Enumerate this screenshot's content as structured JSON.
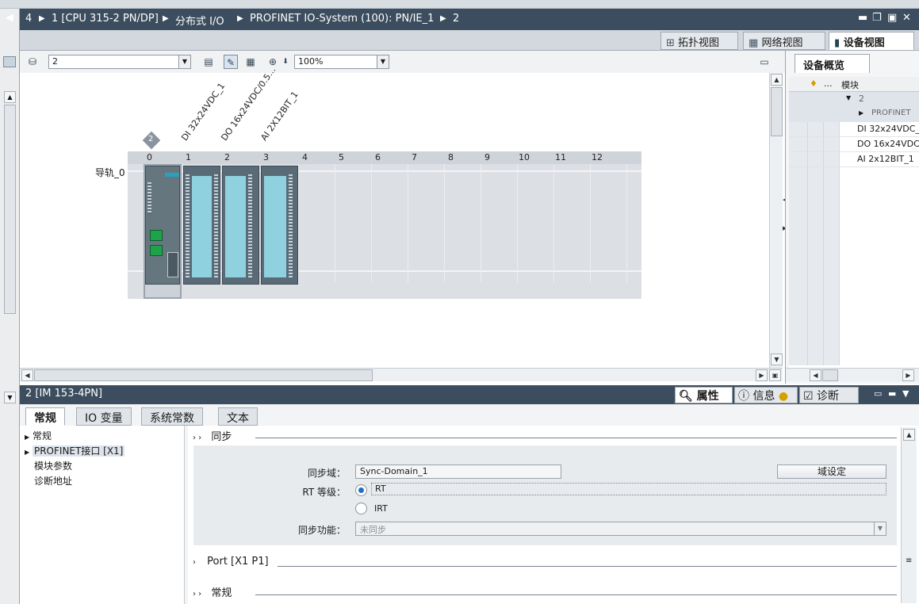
{
  "titlebar": {
    "crumbs": [
      "4",
      "1 [CPU 315-2 PN/DP]",
      "分布式 I/O",
      "PROFINET IO-System (100): PN/IE_1",
      "2"
    ]
  },
  "view_tabs": {
    "topology": "拓扑视图",
    "network": "网络视图",
    "device": "设备视图"
  },
  "device_toolbar": {
    "device_select": "2",
    "zoom": "100%"
  },
  "rack": {
    "rail_label": "导轨_0",
    "slots": [
      "0",
      "1",
      "2",
      "3",
      "4",
      "5",
      "6",
      "7",
      "8",
      "9",
      "10",
      "11",
      "12"
    ],
    "station_badge": "2",
    "module_labels": [
      "DI 32x24VDC_1",
      "DO 16x24VDC/0.5...",
      "AI 2X12BIT_1"
    ]
  },
  "overview": {
    "tab": "设备概览",
    "col_module": "模块",
    "col_dots": "...",
    "rows": [
      "2",
      "PROFINET",
      "DI 32x24VDC_",
      "DO 16x24VDC",
      "AI 2x12BIT_1"
    ]
  },
  "properties": {
    "title": "2 [IM 153-4PN]",
    "tabs": {
      "props": "属性",
      "info": "信息",
      "diag": "诊断"
    },
    "inner_tabs": [
      "常规",
      "IO 变量",
      "系统常数",
      "文本"
    ],
    "nav": [
      "常规",
      "PROFINET接口 [X1]",
      "模块参数",
      "诊断地址"
    ],
    "sections": {
      "sync": "同步",
      "port": "Port [X1 P1]",
      "general": "常规"
    },
    "sync_domain_label": "同步域：",
    "sync_domain_value": "Sync-Domain_1",
    "domain_settings_button": "域设定",
    "rt_class_label": "RT 等级：",
    "rt_option": "RT",
    "irt_option": "IRT",
    "sync_function_label": "同步功能：",
    "sync_function_value": "未同步",
    "rt_selected": "RT"
  },
  "colors": {
    "titlebar": "#3b4d5e",
    "module_body": "#5a6b78",
    "module_window": "#8fd1df",
    "accent": "#1f6fc5"
  }
}
